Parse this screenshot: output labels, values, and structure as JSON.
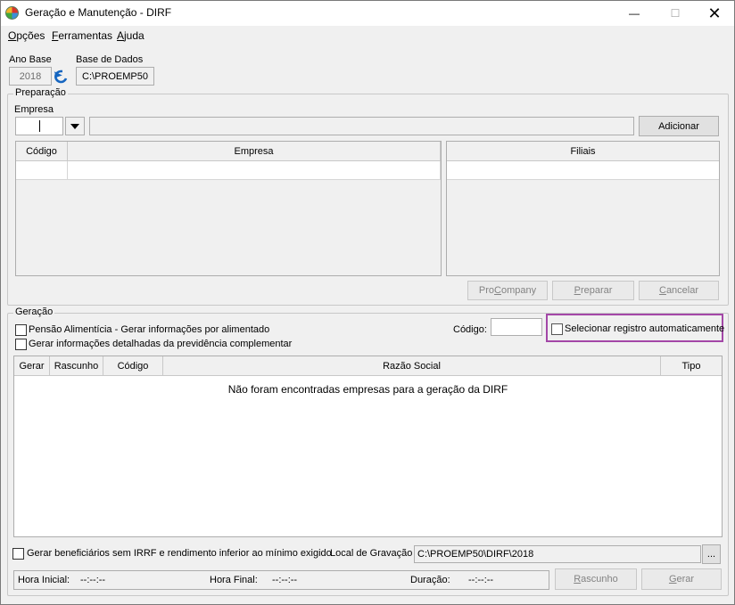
{
  "window": {
    "title": "Geração e Manutenção - DIRF",
    "minimize_glyph": "—",
    "maximize_glyph": "☐",
    "close_glyph": "✕"
  },
  "menu": {
    "opcoes": {
      "first": "O",
      "rest": "pções"
    },
    "ferramentas": {
      "first": "F",
      "rest": "erramentas"
    },
    "ajuda": {
      "first": "A",
      "rest": "juda"
    }
  },
  "header": {
    "ano_base_label": "Ano Base",
    "ano_base_value": "2018",
    "base_dados_label": "Base de Dados",
    "base_dados_value": "C:\\PROEMP50"
  },
  "preparacao": {
    "title": "Preparação",
    "empresa_label": "Empresa",
    "empresa_value": "",
    "empresa_name": "",
    "adicionar_button": "Adicionar",
    "empresas_table": {
      "columns": [
        "Código",
        "Empresa"
      ]
    },
    "filiais_table": {
      "columns": [
        "Filiais"
      ]
    },
    "procompany_button": {
      "before": "Pro",
      "under": "C",
      "after": "ompany"
    },
    "preparar_button": {
      "under": "P",
      "after": "reparar"
    },
    "cancelar_button": {
      "under": "C",
      "after": "ancelar"
    }
  },
  "geracao": {
    "title": "Geração",
    "pensao_label": "Pensão Alimentícia - Gerar informações por alimentado",
    "previdencia_label": "Gerar informações detalhadas da previdência complementar",
    "codigo_label": "Código:",
    "codigo_value": "",
    "selecionar_label": "Selecionar registro automaticamente",
    "highlight_color": "#a347a7",
    "table": {
      "columns": [
        "Gerar",
        "Rascunho",
        "Código",
        "Razão Social",
        "Tipo"
      ],
      "empty_message": "Não foram encontradas empresas para a geração da DIRF"
    }
  },
  "footer": {
    "beneficiarios_label": "Gerar beneficiários sem IRRF e rendimento inferior ao mínimo exigido",
    "local_label": "Local de Gravação",
    "local_value": "C:\\PROEMP50\\DIRF\\2018",
    "browse_button": "...",
    "hora_inicial_label": "Hora Inicial:",
    "hora_inicial_value": "--:--:--",
    "hora_final_label": "Hora Final:",
    "hora_final_value": "--:--:--",
    "duracao_label": "Duração:",
    "duracao_value": "--:--:--",
    "rascunho_button": {
      "under": "R",
      "after": "ascunho"
    },
    "gerar_button": {
      "under": "G",
      "after": "erar"
    }
  },
  "icons": {
    "app": "dirf-app-icon",
    "refresh": "refresh-arrow-icon",
    "dropdown": "chevron-down-icon"
  }
}
